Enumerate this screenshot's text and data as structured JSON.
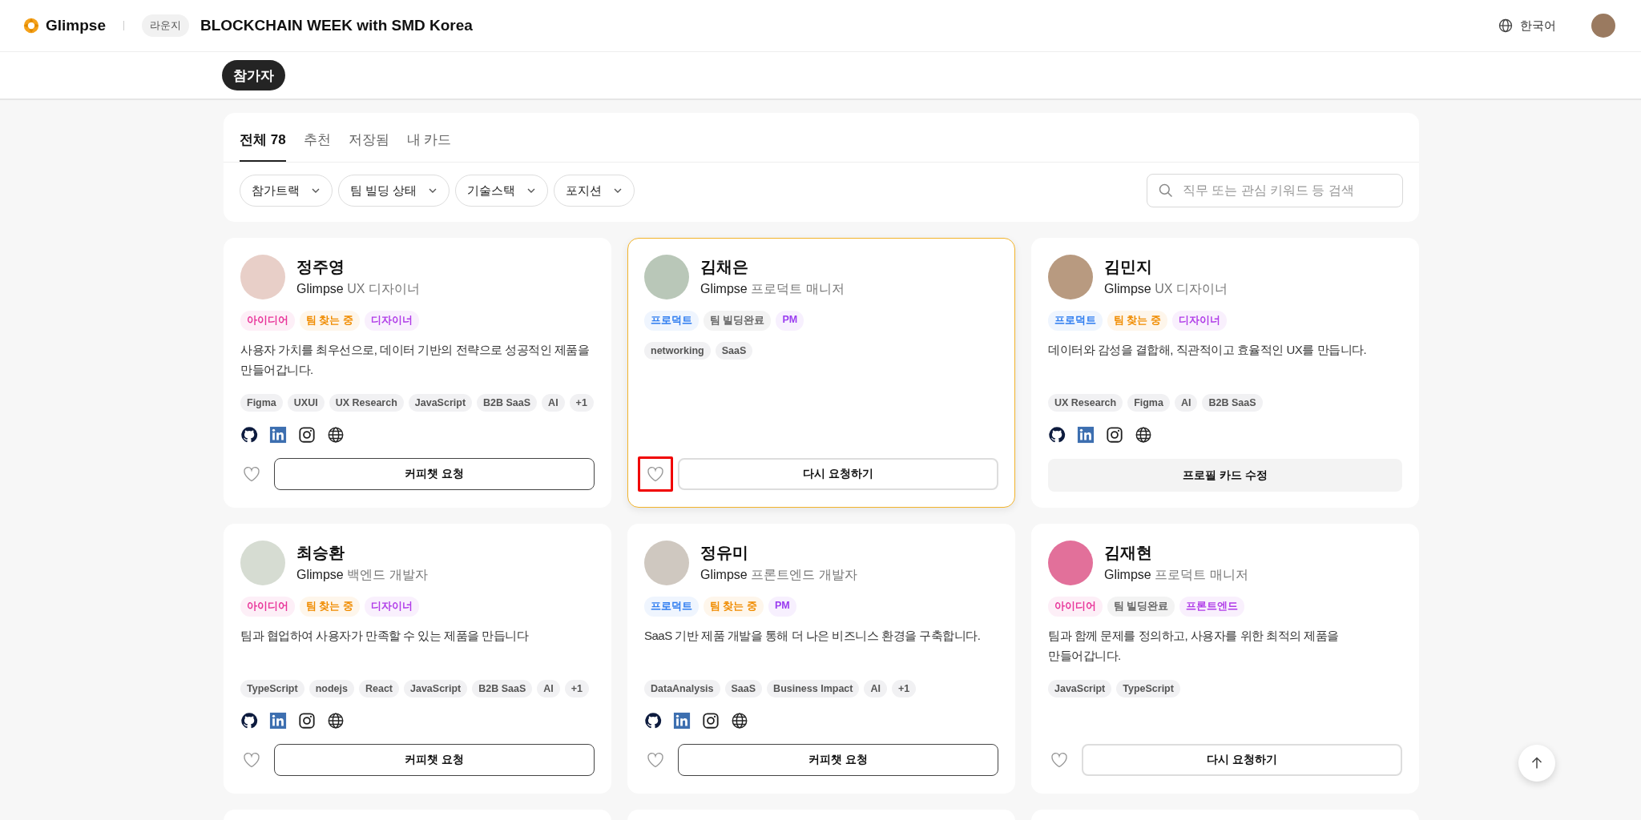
{
  "header": {
    "brand": "Glimpse",
    "section": "라운지",
    "title": "BLOCKCHAIN WEEK with SMD Korea",
    "language": "한국어"
  },
  "nav": [
    {
      "label": "참가자",
      "selected": true
    }
  ],
  "tabs": [
    {
      "label": "전체 78",
      "selected": true
    },
    {
      "label": "추천",
      "selected": false
    },
    {
      "label": "저장됨",
      "selected": false
    },
    {
      "label": "내 카드",
      "selected": false
    }
  ],
  "filters": [
    "참가트랙",
    "팀 빌딩 상태",
    "기술스택",
    "포지션"
  ],
  "search": {
    "placeholder": "직무 또는 관심 키워드 등 검색"
  },
  "cards": [
    {
      "name": "정주영",
      "company": "Glimpse",
      "role": "UX 디자이너",
      "selected": false,
      "badges": [
        {
          "label": "아이디어",
          "color": "#e8359a"
        },
        {
          "label": "팀 찾는 중",
          "color": "#f08c00"
        },
        {
          "label": "디자이너",
          "color": "#b03ce8"
        }
      ],
      "description": "사용자 가치를 최우선으로, 데이터 기반의 전략으로 성공적인 제품을 만들어갑니다.",
      "skills": [
        "Figma",
        "UXUI",
        "UX Research",
        "JavaScript",
        "B2B SaaS",
        "AI",
        "+1"
      ],
      "socials": true,
      "action": {
        "kind": "coffee",
        "label": "커피챗 요청"
      }
    },
    {
      "name": "김채은",
      "company": "Glimpse",
      "role": "프로덕트 매니저",
      "selected": true,
      "heart_highlighted": true,
      "badges": [
        {
          "label": "프로덕트",
          "color": "#2f7df0"
        },
        {
          "label": "팀 빌딩완료",
          "color": "#666666"
        },
        {
          "label": "PM",
          "color": "#9a3cf0"
        }
      ],
      "skills": [
        "networking",
        "SaaS"
      ],
      "socials": false,
      "action": {
        "kind": "rerequest",
        "label": "다시 요청하기"
      }
    },
    {
      "name": "김민지",
      "company": "Glimpse",
      "role": "UX 디자이너",
      "selected": false,
      "badges": [
        {
          "label": "프로덕트",
          "color": "#2f7df0"
        },
        {
          "label": "팀 찾는 중",
          "color": "#f08c00"
        },
        {
          "label": "디자이너",
          "color": "#b03ce8"
        }
      ],
      "description": "데이터와 감성을 결합해, 직관적이고 효율적인 UX를 만듭니다.",
      "skills": [
        "UX Research",
        "Figma",
        "AI",
        "B2B SaaS"
      ],
      "socials": true,
      "action": {
        "kind": "edit",
        "label": "프로필 카드 수정"
      }
    },
    {
      "name": "최승환",
      "company": "Glimpse",
      "role": "백엔드 개발자",
      "selected": false,
      "badges": [
        {
          "label": "아이디어",
          "color": "#e8359a"
        },
        {
          "label": "팀 찾는 중",
          "color": "#f08c00"
        },
        {
          "label": "디자이너",
          "color": "#b03ce8"
        }
      ],
      "description": "팀과 협업하여 사용자가 만족할 수 있는 제품을 만듭니다",
      "skills": [
        "TypeScript",
        "nodejs",
        "React",
        "JavaScript",
        "B2B SaaS",
        "AI",
        "+1"
      ],
      "socials": true,
      "action": {
        "kind": "coffee",
        "label": "커피챗 요청"
      }
    },
    {
      "name": "정유미",
      "company": "Glimpse",
      "role": "프론트엔드 개발자",
      "selected": false,
      "badges": [
        {
          "label": "프로덕트",
          "color": "#2f7df0"
        },
        {
          "label": "팀 찾는 중",
          "color": "#f08c00"
        },
        {
          "label": "PM",
          "color": "#9a3cf0"
        }
      ],
      "description": "SaaS 기반 제품 개발을 통해 더 나은 비즈니스 환경을 구축합니다.",
      "skills": [
        "DataAnalysis",
        "SaaS",
        "Business Impact",
        "AI",
        "+1"
      ],
      "socials": true,
      "action": {
        "kind": "coffee",
        "label": "커피챗 요청"
      }
    },
    {
      "name": "김재현",
      "company": "Glimpse",
      "role": "프로덕트 매니저",
      "selected": false,
      "badges": [
        {
          "label": "아이디어",
          "color": "#e8359a"
        },
        {
          "label": "팀 빌딩완료",
          "color": "#666666"
        },
        {
          "label": "프론트엔드",
          "color": "#b03ce8"
        }
      ],
      "description": "팀과 함께 문제를 정의하고, 사용자를 위한 최적의 제품을 만들어갑니다.",
      "skills": [
        "JavaScript",
        "TypeScript"
      ],
      "socials": false,
      "action": {
        "kind": "rerequest",
        "label": "다시 요청하기"
      }
    }
  ]
}
